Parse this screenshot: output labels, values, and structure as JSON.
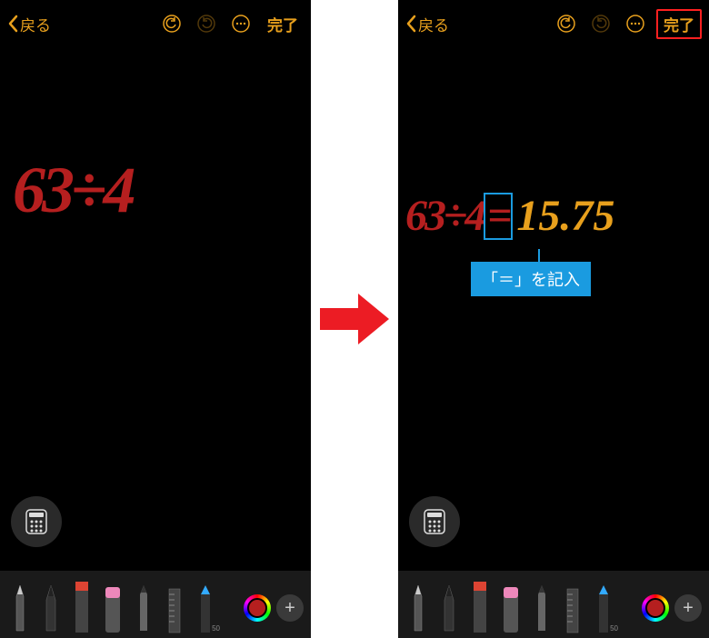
{
  "colors": {
    "accent": "#e8a01d",
    "ink": "#b51f1f",
    "callout": "#1a9be0",
    "highlight_border": "#ff2020"
  },
  "topbar": {
    "back_label": "戻る",
    "done_label": "完了"
  },
  "left_screen": {
    "equation": "63÷4"
  },
  "right_screen": {
    "equation": "63÷4",
    "equals": "=",
    "result": "15.75",
    "callout_text": "「＝」を記入"
  },
  "toolbar": {
    "tools": [
      {
        "name": "pen"
      },
      {
        "name": "fountain-pen"
      },
      {
        "name": "marker"
      },
      {
        "name": "eraser"
      },
      {
        "name": "pencil"
      },
      {
        "name": "ruler"
      },
      {
        "name": "highlighter",
        "size_label": "50"
      }
    ],
    "add_label": "+"
  }
}
